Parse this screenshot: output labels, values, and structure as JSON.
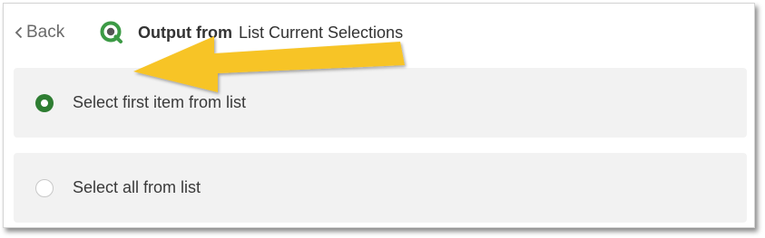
{
  "header": {
    "back_label": "Back",
    "title_bold": "Output from",
    "title_rest": "List Current Selections"
  },
  "options": [
    {
      "label": "Select first item from list",
      "selected": true
    },
    {
      "label": "Select all from list",
      "selected": false
    }
  ],
  "colors": {
    "radio_selected": "#2e7d32",
    "option_background": "#f2f2f2",
    "arrow": "#f7c427"
  },
  "icons": {
    "logo": "qlik-logo-icon",
    "back": "chevron-left-icon",
    "annotation": "yellow-arrow-annotation"
  }
}
